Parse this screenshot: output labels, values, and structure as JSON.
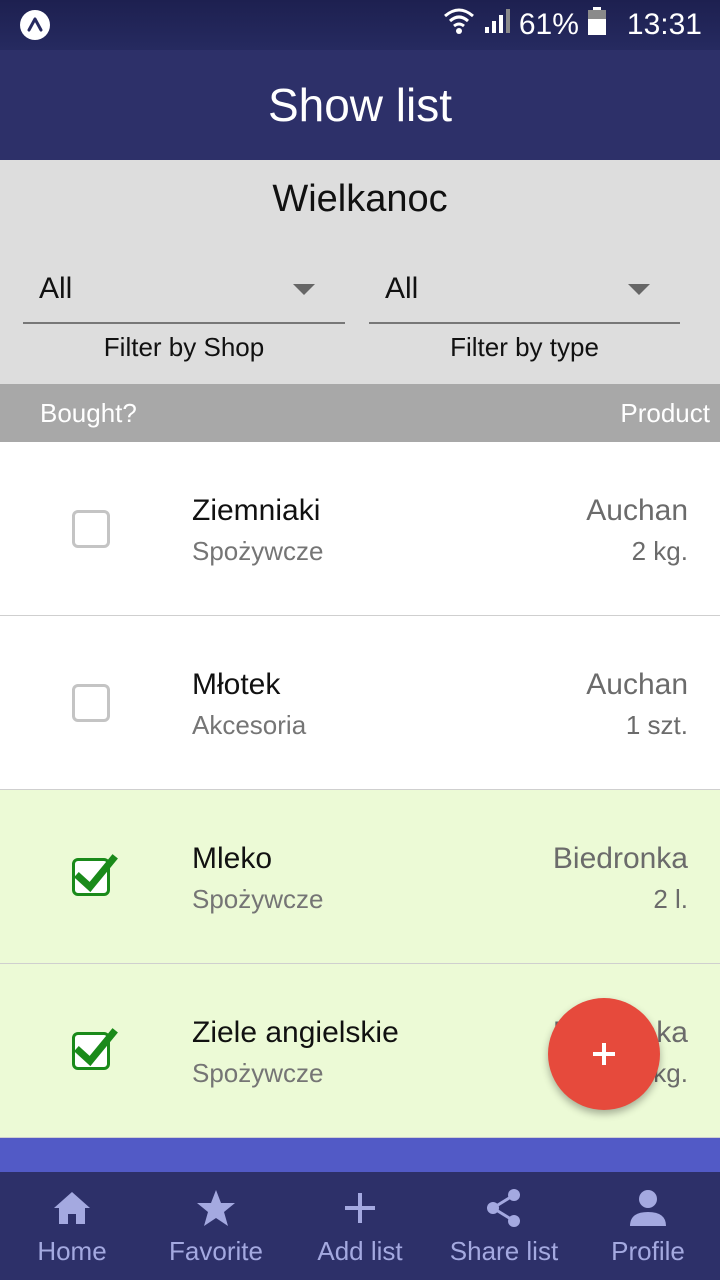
{
  "status_bar": {
    "battery_percent": "61%",
    "time": "13:31"
  },
  "app_bar": {
    "title": "Show list"
  },
  "list_header": {
    "list_name": "Wielkanoc",
    "shop_filter": {
      "value": "All",
      "label": "Filter by Shop"
    },
    "type_filter": {
      "value": "All",
      "label": "Filter by type"
    }
  },
  "columns": {
    "bought": "Bought?",
    "product": "Product"
  },
  "items": [
    {
      "name": "Ziemniaki",
      "type": "Spożywcze",
      "shop": "Auchan",
      "quantity": "2 kg.",
      "bought": false
    },
    {
      "name": "Młotek",
      "type": "Akcesoria",
      "shop": "Auchan",
      "quantity": "1 szt.",
      "bought": false
    },
    {
      "name": "Mleko",
      "type": "Spożywcze",
      "shop": "Biedronka",
      "quantity": "2 l.",
      "bought": true
    },
    {
      "name": "Ziele angielskie",
      "type": "Spożywcze",
      "shop": "Biedronka",
      "quantity": "1 kg.",
      "bought": true
    }
  ],
  "fab": {
    "icon": "plus-icon",
    "color": "#e64a3c"
  },
  "bottom_nav": [
    {
      "label": "Home",
      "icon": "home-icon"
    },
    {
      "label": "Favorite",
      "icon": "star-icon"
    },
    {
      "label": "Add list",
      "icon": "plus-icon"
    },
    {
      "label": "Share list",
      "icon": "share-icon"
    },
    {
      "label": "Profile",
      "icon": "person-icon"
    }
  ],
  "colors": {
    "primary": "#2d3069",
    "accent": "#525ac6",
    "bought_row": "#ecfad6",
    "checkbox_checked": "#1a8a1a",
    "nav_label": "#a4a9e0"
  }
}
